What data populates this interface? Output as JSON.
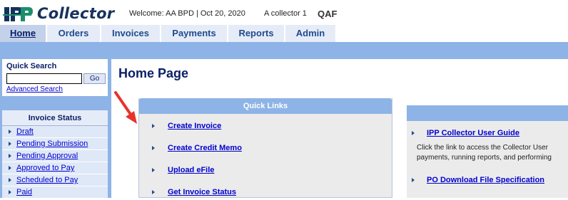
{
  "app": {
    "logo_text": "Collector",
    "logo_mark": "IPP",
    "welcome": "Welcome: AA BPD | Oct 20, 2020",
    "collector": "A collector 1",
    "environment": "QAF",
    "brand_color": "#16325c",
    "accent_color": "#8eb3e6"
  },
  "nav": {
    "tabs": [
      {
        "label": "Home",
        "active": true
      },
      {
        "label": "Orders"
      },
      {
        "label": "Invoices"
      },
      {
        "label": "Payments"
      },
      {
        "label": "Reports"
      },
      {
        "label": "Admin"
      }
    ]
  },
  "quick_search": {
    "title": "Quick Search",
    "input_value": "",
    "go_label": "Go",
    "advanced_label": "Advanced Search"
  },
  "invoice_status": {
    "title": "Invoice Status",
    "items": [
      "Draft",
      "Pending Submission",
      "Pending Approval",
      "Approved to Pay",
      "Scheduled to Pay",
      "Paid"
    ]
  },
  "main": {
    "page_title": "Home Page",
    "quick_links": {
      "title": "Quick Links",
      "items": [
        "Create Invoice",
        "Create Credit Memo",
        "Upload eFile",
        "Get Invoice Status"
      ]
    },
    "resources": {
      "items": [
        "IPP Collector User Guide",
        "PO Download File Specification"
      ],
      "description_lines": [
        "Click the link to access the Collector User",
        "payments, running reports, and performing"
      ]
    }
  },
  "icons": [
    "logo-icon",
    "arrow-right-icon",
    "red-pointer-arrow-icon"
  ]
}
